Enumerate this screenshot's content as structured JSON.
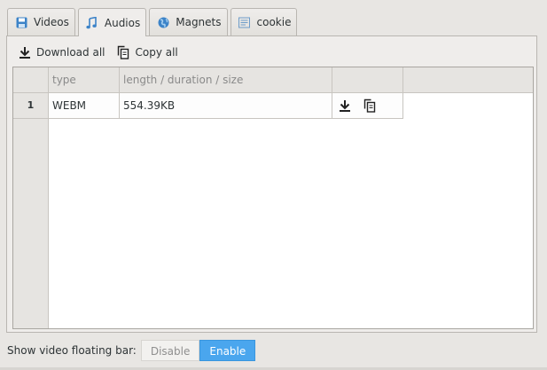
{
  "tabs": [
    {
      "label": "Videos",
      "icon": "video-file-icon",
      "active": false
    },
    {
      "label": "Audios",
      "icon": "music-note-icon",
      "active": true
    },
    {
      "label": "Magnets",
      "icon": "globe-icon",
      "active": false
    },
    {
      "label": "cookie",
      "icon": "cookie-list-icon",
      "active": false
    }
  ],
  "toolbar": {
    "download_all": "Download all",
    "copy_all": "Copy all"
  },
  "table": {
    "columns": [
      "type",
      "length / duration / size",
      ""
    ],
    "rows": [
      {
        "index": "1",
        "type": "WEBM",
        "size": "554.39KB"
      }
    ]
  },
  "bottom": {
    "label": "Show video floating bar:",
    "disable": "Disable",
    "enable": "Enable",
    "selected": "Enable"
  },
  "colors": {
    "accent": "#4aa6ee",
    "icon_blue": "#3c83c8"
  }
}
